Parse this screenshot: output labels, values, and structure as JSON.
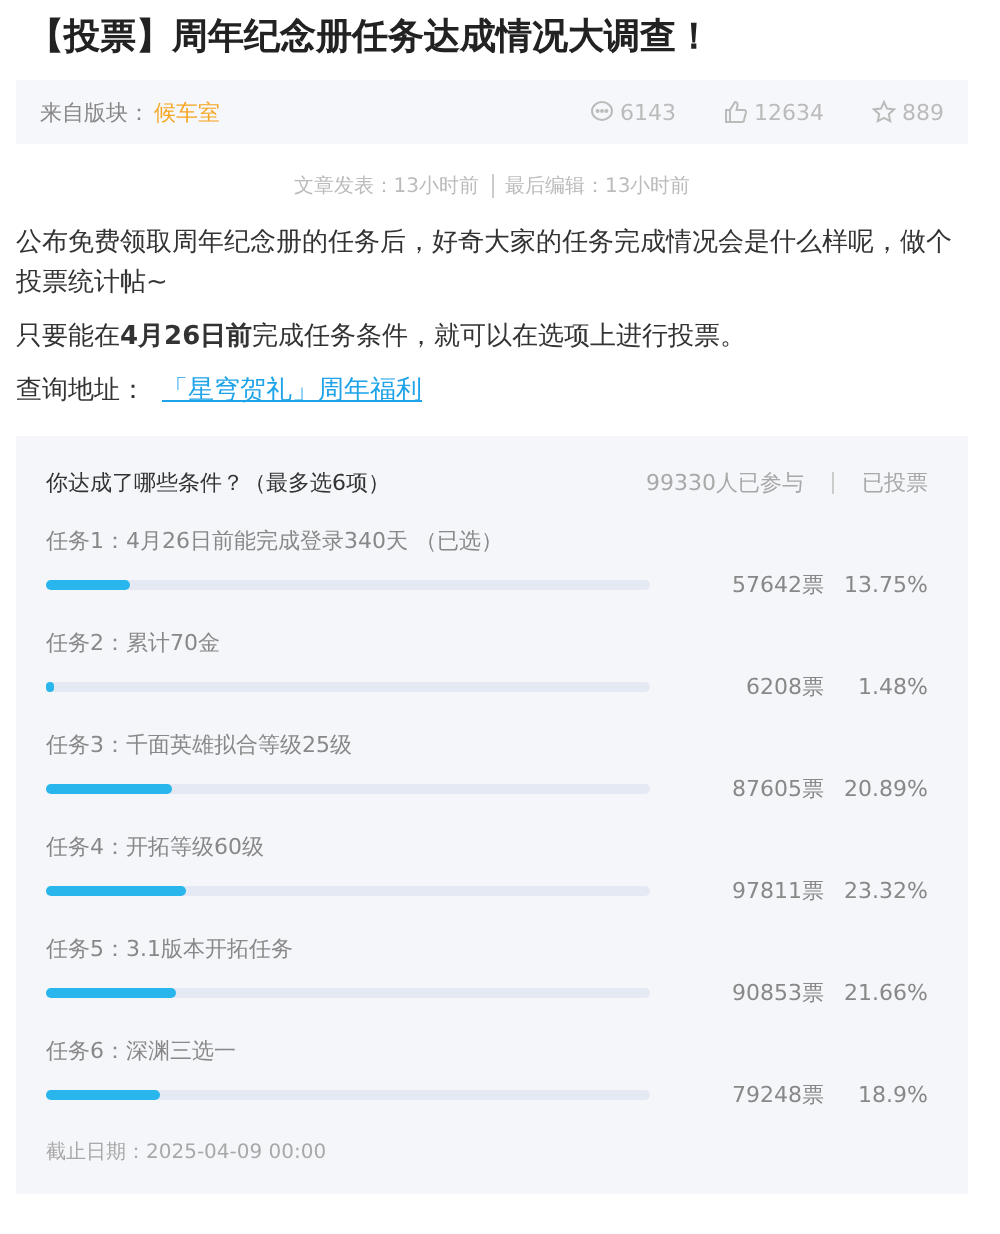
{
  "title": "【投票】周年纪念册任务达成情况大调查！",
  "meta": {
    "board_label": "来自版块：",
    "board": "候车室",
    "comments": "6143",
    "likes": "12634",
    "favorites": "889"
  },
  "times": {
    "published": "文章发表：13小时前",
    "edited": "最后编辑：13小时前"
  },
  "body": {
    "paragraphs": [
      "公布免费领取周年纪念册的任务后，好奇大家的任务完成情况会是什么样呢，做个投票统计帖~",
      "只要能在**4月26日前**完成任务条件，就可以在选项上进行投票。"
    ],
    "link_label": "查询地址：",
    "link": "「星穹贺礼」周年福利"
  },
  "poll": {
    "question": "你达成了哪些条件？（最多选6项）",
    "participants": "99330人已参与",
    "status": "已投票",
    "options": [
      {
        "label": "任务1：4月26日前能完成登录340天 （已选）",
        "level": 0.1375,
        "votes": "57642票",
        "percent": "13.75%"
      },
      {
        "label": "任务2：累计70金",
        "level": 0.0148,
        "votes": "6208票",
        "percent": "1.48%"
      },
      {
        "label": "任务3：千面英雄拟合等级25级",
        "level": 0.2089,
        "votes": "87605票",
        "percent": "20.89%"
      },
      {
        "label": "任务4：开拓等级60级",
        "level": 0.2332,
        "votes": "97811票",
        "percent": "23.32%"
      },
      {
        "label": "任务5：3.1版本开拓任务",
        "level": 0.2166,
        "votes": "90853票",
        "percent": "21.66%"
      },
      {
        "label": "任务6：深渊三选一",
        "level": 0.189,
        "votes": "79248票",
        "percent": "18.9%"
      }
    ],
    "deadline": "截止日期：2025-04-09 00:00"
  }
}
